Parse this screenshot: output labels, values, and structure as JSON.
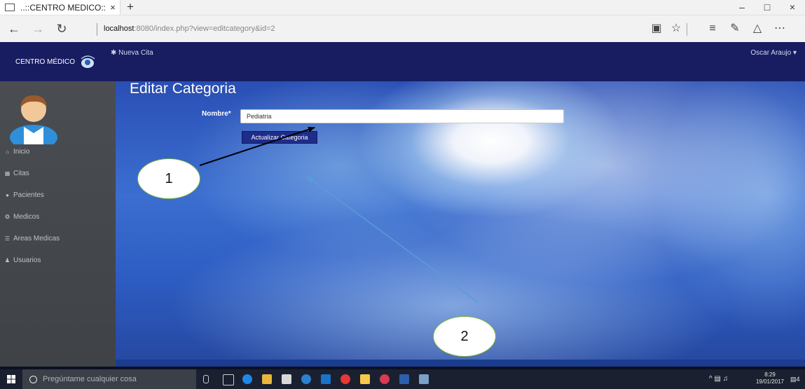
{
  "browser": {
    "tab_title": "..::CENTRO MEDICO::..",
    "tab_close": "×",
    "new_tab": "+",
    "url_host": "localhost",
    "url_path": ":8080/index.php?view=editcategory&id=2",
    "controls": {
      "minimize": "–",
      "restore": "□",
      "close": "×"
    }
  },
  "navbar": {
    "brand": "CENTRO MÉDICO",
    "nueva_cita": "Nueva Cita",
    "user": "Oscar Araujo"
  },
  "sidebar": {
    "items": [
      {
        "label": "Inicio",
        "icon": "home-icon"
      },
      {
        "label": "Citas",
        "icon": "calendar-icon"
      },
      {
        "label": "Pacientes",
        "icon": "person-icon"
      },
      {
        "label": "Medicos",
        "icon": "support-icon"
      },
      {
        "label": "Areas Medicas",
        "icon": "list-icon"
      },
      {
        "label": "Usuarios",
        "icon": "users-icon"
      }
    ]
  },
  "main": {
    "title": "Editar Categoria",
    "field_label": "Nombre*",
    "field_value": "Pediatria",
    "button": "Actualizar Categoria"
  },
  "annotations": {
    "callout_1": "1",
    "callout_2": "2"
  },
  "taskbar": {
    "search_placeholder": "Pregúntame cualquier cosa",
    "time": "8:29",
    "date": "19/01/2017",
    "notifications": "4"
  },
  "colors": {
    "navbar": "#181d62",
    "sidebar": "#45484d",
    "button": "#1e2d8a",
    "arrow_1": "#000000",
    "arrow_2": "#5b9bd5",
    "callout_border": "#77b03b"
  }
}
